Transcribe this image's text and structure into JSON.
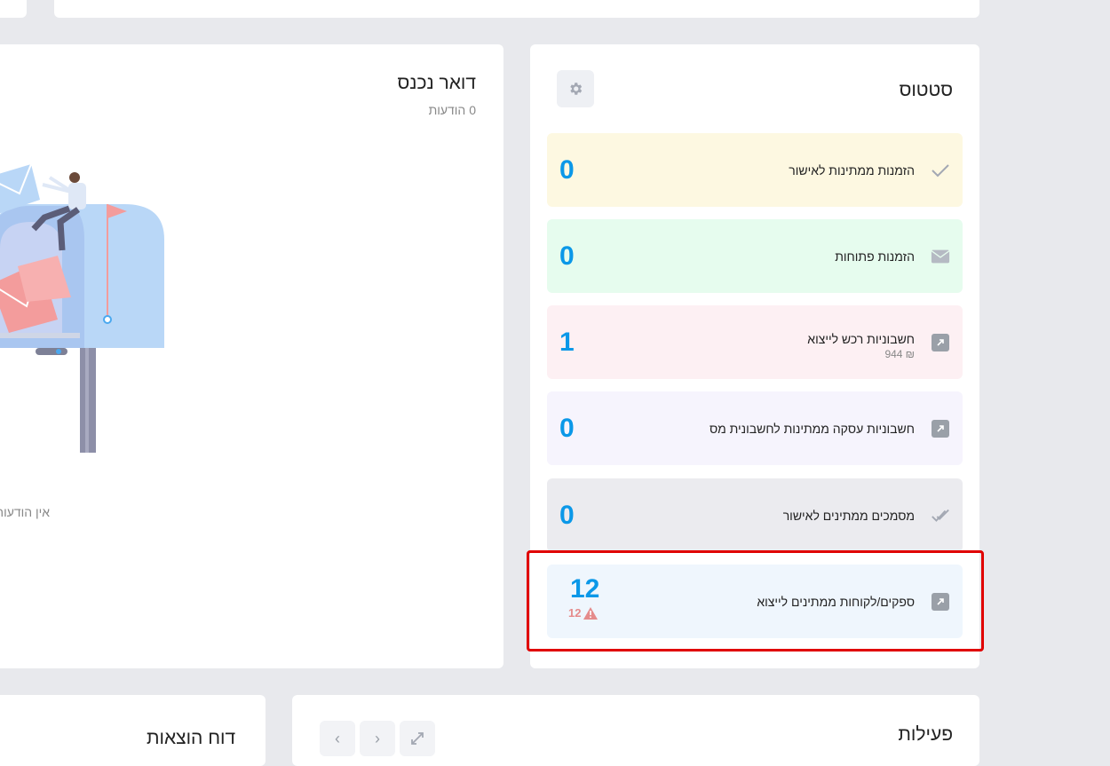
{
  "status": {
    "title": "סטטוס",
    "items": [
      {
        "label": "הזמנות ממתינות לאישור",
        "value": "0",
        "icon": "check-icon",
        "bg": "#fdf8e1"
      },
      {
        "label": "הזמנות פתוחות",
        "value": "0",
        "icon": "envelope-icon",
        "bg": "#e6fcee"
      },
      {
        "label": "חשבוניות רכש לייצוא",
        "sub": "₪ 944",
        "value": "1",
        "icon": "export-icon",
        "bg": "#fdf0f3"
      },
      {
        "label": "חשבוניות עסקה ממתינות לחשבונית מס",
        "value": "0",
        "icon": "export-icon",
        "bg": "#f6f4fd"
      },
      {
        "label": "מסמכים ממתינים לאישור",
        "value": "0",
        "icon": "double-check-icon",
        "bg": "#ebebef"
      },
      {
        "label": "ספקים/לקוחות ממתינים לייצוא",
        "value": "12",
        "warning": "12",
        "icon": "export-icon",
        "bg": "#eff6fd"
      }
    ]
  },
  "inbox": {
    "title": "דואר נכנס",
    "count": "0 הודעות",
    "empty": "אין הודעות חדשות"
  },
  "activity": {
    "title": "פעילות"
  },
  "expense": {
    "title": "דוח הוצאות"
  },
  "colors": {
    "accent": "#0b98e8",
    "highlight": "#e00000"
  }
}
